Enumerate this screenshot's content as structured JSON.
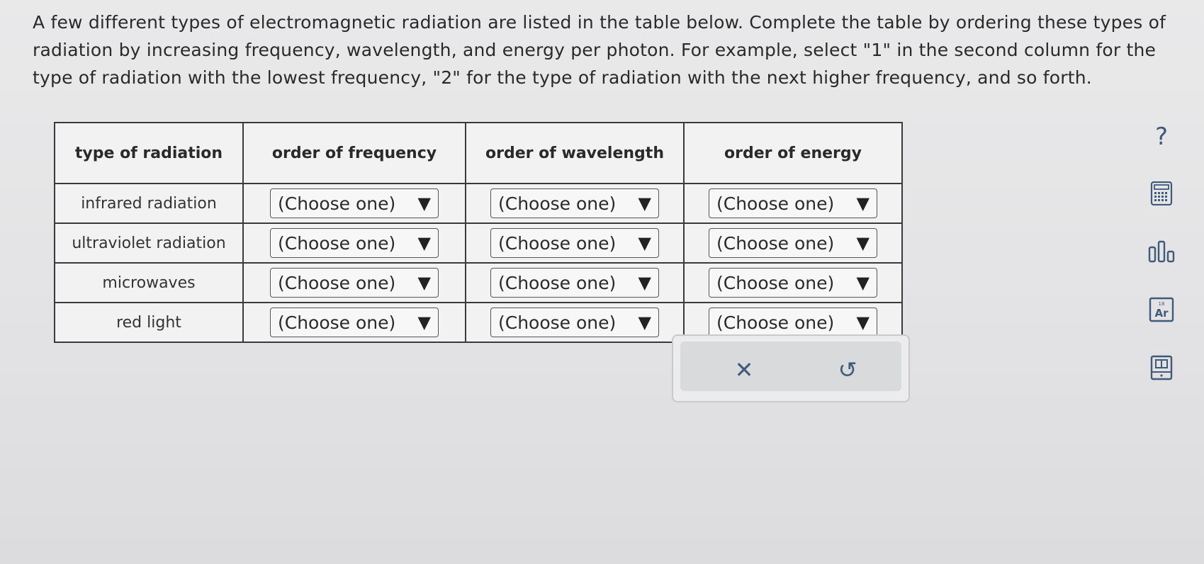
{
  "question": {
    "text": "A few different types of electromagnetic radiation are listed in the table below. Complete the table by ordering these types of radiation by increasing frequency, wavelength, and energy per photon. For example, select \"1\" in the second column for the type of radiation with the lowest frequency, \"2\" for the type of radiation with the next higher frequency, and so forth."
  },
  "table": {
    "headers": [
      "type of radiation",
      "order of frequency",
      "order of wavelength",
      "order of energy"
    ],
    "rows": [
      {
        "type": "infrared radiation",
        "frequency": "(Choose one)",
        "wavelength": "(Choose one)",
        "energy": "(Choose one)"
      },
      {
        "type": "ultraviolet radiation",
        "frequency": "(Choose one)",
        "wavelength": "(Choose one)",
        "energy": "(Choose one)"
      },
      {
        "type": "microwaves",
        "frequency": "(Choose one)",
        "wavelength": "(Choose one)",
        "energy": "(Choose one)"
      },
      {
        "type": "red light",
        "frequency": "(Choose one)",
        "wavelength": "(Choose one)",
        "energy": "(Choose one)"
      }
    ]
  },
  "actions": {
    "clear_symbol": "✕",
    "undo_symbol": "↺"
  },
  "tools": {
    "help_symbol": "?",
    "periodic_number": "18",
    "periodic_symbol": "Ar",
    "icons": [
      "help-icon",
      "calculator-icon",
      "data-chart-icon",
      "periodic-table-icon",
      "reference-book-icon"
    ]
  },
  "colors": {
    "accent": "#3f5b79",
    "background": "#e6e6e8",
    "border": "#3a3a3a"
  }
}
